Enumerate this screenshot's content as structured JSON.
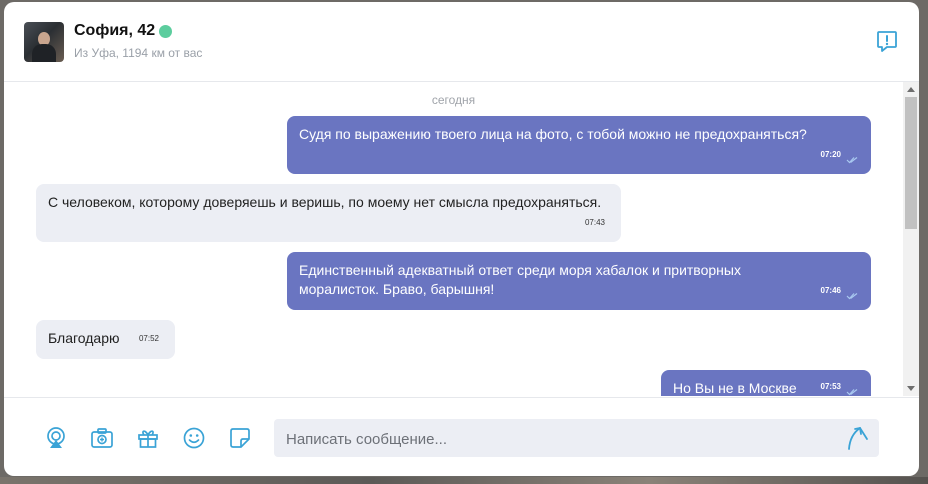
{
  "header": {
    "name": "София, 42",
    "location": "Из Уфа, 1194 км от вас"
  },
  "chat": {
    "date_separator": "сегодня",
    "messages": [
      {
        "direction": "out",
        "text": "Судя по выражению твоего лица на фото, с тобой можно не предохраняться?",
        "time": "07:20",
        "read": true
      },
      {
        "direction": "in",
        "text": "С человеком, которому доверяешь и веришь, по моему нет смысла предохраняться.",
        "time": "07:43"
      },
      {
        "direction": "out",
        "text": "Единственный адекватный ответ среди моря хабалок и притворных моралисток. Браво, барышня!",
        "time": "07:46",
        "read": true
      },
      {
        "direction": "in",
        "text": "Благодарю",
        "time": "07:52"
      },
      {
        "direction": "out",
        "text": "Но Вы не в Москве",
        "time": "07:53",
        "read": true
      }
    ]
  },
  "composer": {
    "placeholder": "Написать сообщение...",
    "tools": [
      "location-icon",
      "camera-icon",
      "gift-icon",
      "emoji-icon",
      "sticker-icon"
    ]
  },
  "colors": {
    "outgoing_bubble": "#6a75c1",
    "incoming_bubble": "#eceef4",
    "accent": "#3aa3d6",
    "online": "#5ccd9e"
  }
}
